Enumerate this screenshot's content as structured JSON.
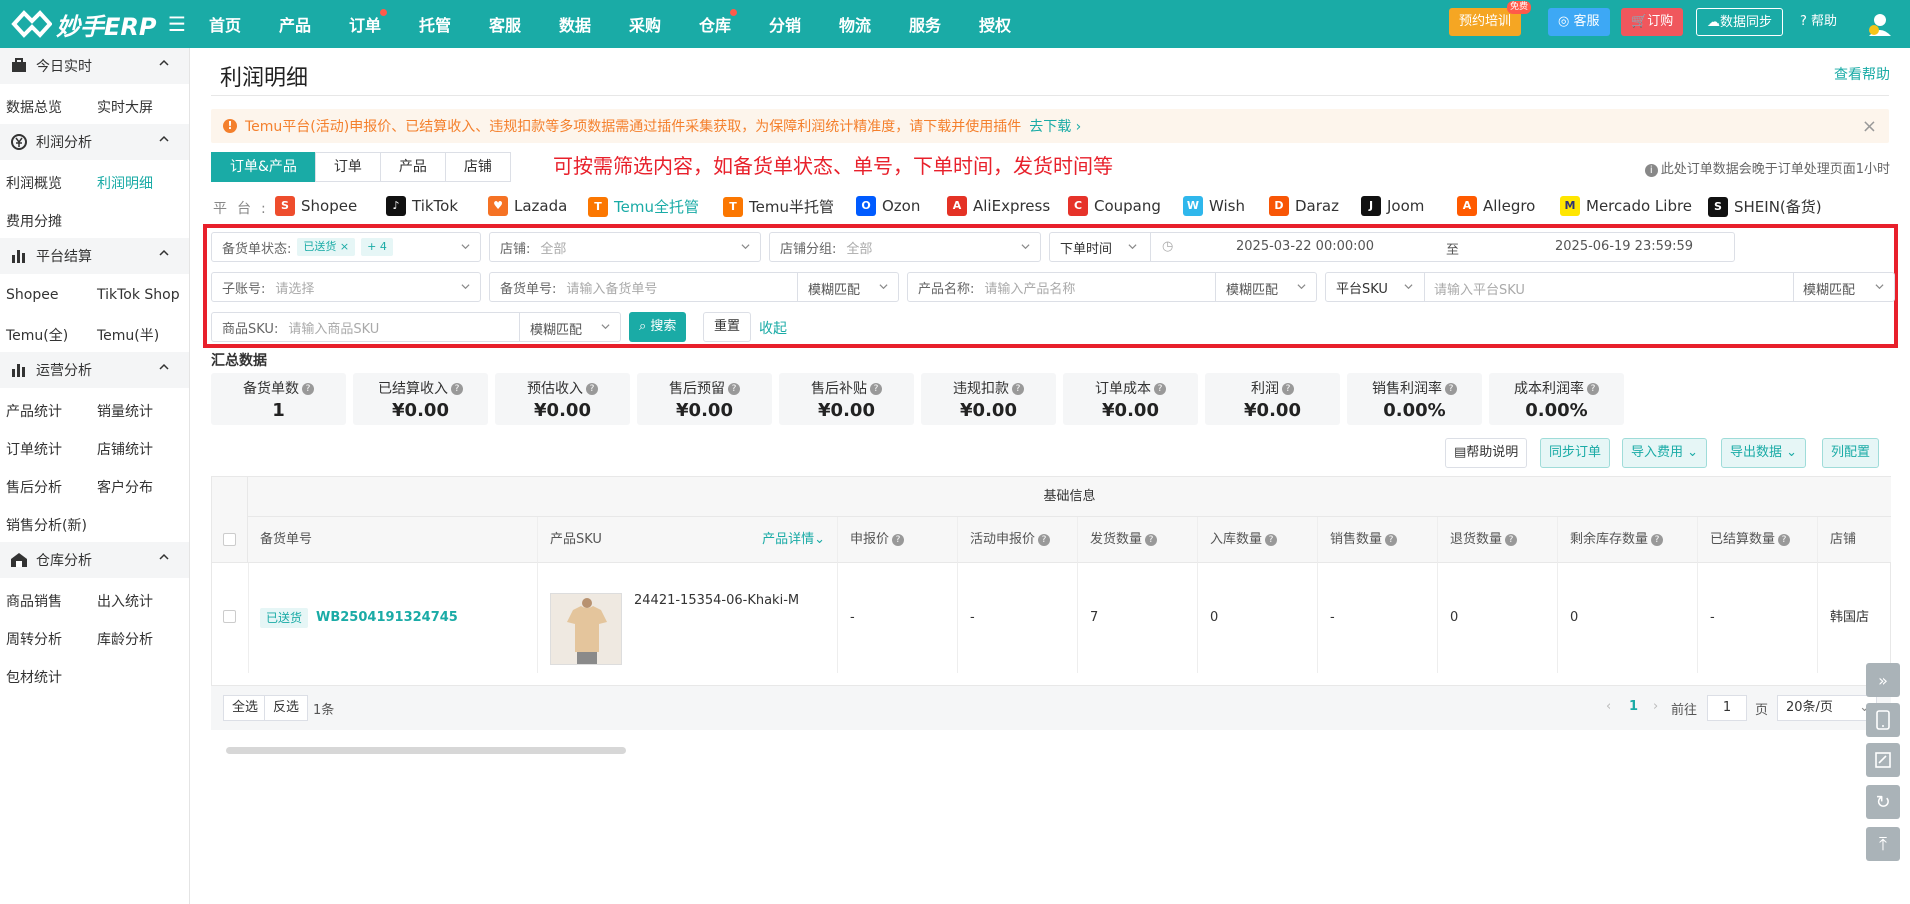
{
  "app": {
    "logo_text": "妙手ERP",
    "nav": [
      {
        "label": "首页",
        "dot": false
      },
      {
        "label": "产品",
        "dot": false
      },
      {
        "label": "订单",
        "dot": true
      },
      {
        "label": "托管",
        "dot": false
      },
      {
        "label": "客服",
        "dot": false
      },
      {
        "label": "数据",
        "dot": false
      },
      {
        "label": "采购",
        "dot": false
      },
      {
        "label": "仓库",
        "dot": true
      },
      {
        "label": "分销",
        "dot": false
      },
      {
        "label": "物流",
        "dot": false
      },
      {
        "label": "服务",
        "dot": false
      },
      {
        "label": "授权",
        "dot": false
      }
    ],
    "top_buttons": {
      "training": "预约培训",
      "free_badge": "免费",
      "service": "客服",
      "order": "订购",
      "sync": "数据同步",
      "help": "帮助"
    }
  },
  "sidebar": {
    "groups": [
      {
        "label": "今日实时",
        "icon": "briefcase-icon"
      },
      {
        "label": "利润分析",
        "icon": "yen-circle-icon"
      },
      {
        "label": "平台结算",
        "icon": "bar-chart-icon"
      },
      {
        "label": "运营分析",
        "icon": "bar-chart-icon"
      },
      {
        "label": "仓库分析",
        "icon": "warehouse-icon"
      }
    ],
    "items": [
      "数据总览",
      "实时大屏",
      "利润概览",
      "利润明细",
      "费用分摊",
      "Shopee",
      "TikTok Shop",
      "Temu(全)",
      "Temu(半)",
      "产品统计",
      "销量统计",
      "订单统计",
      "店铺统计",
      "售后分析",
      "客户分布",
      "销售分析(新)",
      "商品销售",
      "出入统计",
      "周转分析",
      "库龄分析",
      "包材统计"
    ],
    "active_item": "利润明细"
  },
  "page": {
    "title": "利润明细",
    "help_link": "查看帮助",
    "notice": "Temu平台(活动)申报价、已结算收入、违规扣款等多项数据需通过插件采集获取，为保障利润统计精准度，请下载并使用插件",
    "notice_link": "去下载",
    "tabs": [
      "订单&产品",
      "订单",
      "产品",
      "店铺"
    ],
    "annotation": "可按需筛选内容，如备货单状态、单号，下单时间，发货时间等",
    "delay_tip": "此处订单数据会晚于订单处理页面1小时",
    "platform_label": "平台:",
    "platforms": [
      {
        "name": "Shopee",
        "color": "#ee4d2d",
        "glyph": "S"
      },
      {
        "name": "TikTok",
        "color": "#111111",
        "glyph": "♪"
      },
      {
        "name": "Lazada",
        "color": "#f57224",
        "glyph": "♥"
      },
      {
        "name": "Temu全托管",
        "color": "#fb7701",
        "glyph": "T"
      },
      {
        "name": "Temu半托管",
        "color": "#fb7701",
        "glyph": "T"
      },
      {
        "name": "Ozon",
        "color": "#005bff",
        "glyph": "O"
      },
      {
        "name": "AliExpress",
        "color": "#e43225",
        "glyph": "A"
      },
      {
        "name": "Coupang",
        "color": "#e6332a",
        "glyph": "C"
      },
      {
        "name": "Wish",
        "color": "#2fb7ec",
        "glyph": "W"
      },
      {
        "name": "Daraz",
        "color": "#f85606",
        "glyph": "D"
      },
      {
        "name": "Joom",
        "color": "#111111",
        "glyph": "J"
      },
      {
        "name": "Allegro",
        "color": "#ff5a00",
        "glyph": "A"
      },
      {
        "name": "Mercado Libre",
        "color": "#ffe600",
        "glyph": "M"
      },
      {
        "name": "SHEIN(备货)",
        "color": "#111111",
        "glyph": "S"
      }
    ],
    "active_platform": "Temu全托管"
  },
  "filters": {
    "status_label": "备货单状态:",
    "status_chip": "已送货",
    "status_more": "+ 4",
    "store_label": "店铺:",
    "store_value": "全部",
    "store_group_label": "店铺分组:",
    "store_group_value": "全部",
    "time_type": "下单时间",
    "date_start": "2025-03-22 00:00:00",
    "date_sep": "至",
    "date_end": "2025-06-19 23:59:59",
    "sub_account_label": "子账号:",
    "sub_account_placeholder": "请选择",
    "order_no_label": "备货单号:",
    "order_no_placeholder": "请输入备货单号",
    "match_mode": "模糊匹配",
    "product_name_label": "产品名称:",
    "product_name_placeholder": "请输入产品名称",
    "platform_sku_type": "平台SKU",
    "platform_sku_placeholder": "请输入平台SKU",
    "goods_sku_label": "商品SKU:",
    "goods_sku_placeholder": "请输入商品SKU",
    "search": "搜索",
    "reset": "重置",
    "collapse": "收起"
  },
  "summary": {
    "title": "汇总数据",
    "cards": [
      {
        "label": "备货单数",
        "value": "1"
      },
      {
        "label": "已结算收入",
        "value": "¥0.00"
      },
      {
        "label": "预估收入",
        "value": "¥0.00"
      },
      {
        "label": "售后预留",
        "value": "¥0.00"
      },
      {
        "label": "售后补贴",
        "value": "¥0.00"
      },
      {
        "label": "违规扣款",
        "value": "¥0.00"
      },
      {
        "label": "订单成本",
        "value": "¥0.00"
      },
      {
        "label": "利润",
        "value": "¥0.00"
      },
      {
        "label": "销售利润率",
        "value": "0.00%"
      },
      {
        "label": "成本利润率",
        "value": "0.00%"
      }
    ]
  },
  "actions": {
    "help": "帮助说明",
    "sync": "同步订单",
    "import": "导入费用",
    "export": "导出数据",
    "columns": "列配置"
  },
  "table": {
    "group_header": "基础信息",
    "columns": [
      "备货单号",
      "产品SKU",
      "申报价",
      "活动申报价",
      "发货数量",
      "入库数量",
      "销售数量",
      "退货数量",
      "剩余库存数量",
      "已结算数量",
      "店铺"
    ],
    "product_detail": "产品详情",
    "rows": [
      {
        "status": "已送货",
        "order_no": "WB2504191324745",
        "sku": "24421-15354-06-Khaki-M",
        "declared_price": "-",
        "activity_price": "-",
        "shipped_qty": "7",
        "stocked_qty": "0",
        "sold_qty": "-",
        "returned_qty": "0",
        "remaining_qty": "0",
        "settled_qty": "-",
        "store": "韩国店"
      }
    ]
  },
  "footer": {
    "select_all": "全选",
    "invert": "反选",
    "count": "1条",
    "current_page": "1",
    "goto_label": "前往",
    "goto_value": "1",
    "page_unit": "页",
    "page_size": "20条/页"
  }
}
